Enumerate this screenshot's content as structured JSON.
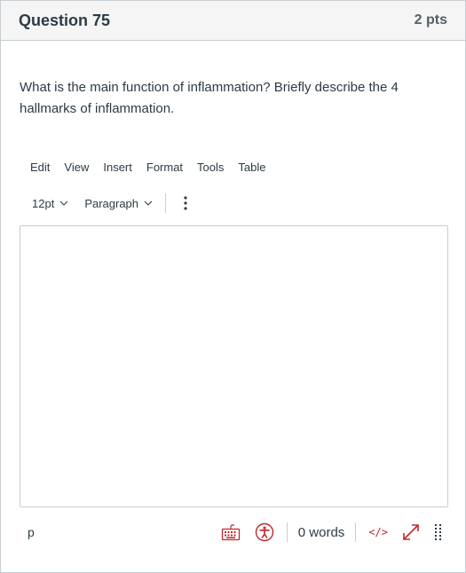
{
  "question": {
    "title": "Question 75",
    "points": "2 pts",
    "text": "What is the main function of inflammation? Briefly describe the 4 hallmarks of inflammation."
  },
  "editor": {
    "menu": [
      "Edit",
      "View",
      "Insert",
      "Format",
      "Tools",
      "Table"
    ],
    "font_size": "12pt",
    "block_format": "Paragraph",
    "content": "",
    "status": {
      "path": "p",
      "word_count": "0 words",
      "html_toggle": "</>"
    },
    "icons": {
      "keyboard": "keyboard-shortcuts-icon",
      "accessibility": "accessibility-checker-icon",
      "fullscreen": "fullscreen-expand-icon",
      "resize": "resize-grip-icon",
      "more": "kebab-vertical-icon"
    }
  },
  "colors": {
    "accent": "#c1272d",
    "text": "#2d3b45",
    "border": "#c7cdd1",
    "header_bg": "#f5f5f5"
  }
}
